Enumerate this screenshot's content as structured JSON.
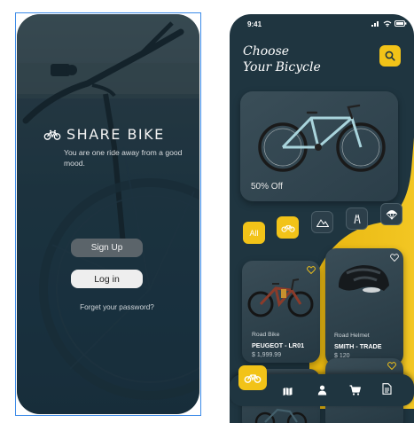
{
  "welcome": {
    "brand_name": "SHARE BIKE",
    "tagline": "You are one ride away from a good mood.",
    "signup_label": "Sign Up",
    "login_label": "Log in",
    "forgot_label": "Forget your password?"
  },
  "shop": {
    "status_time": "9:41",
    "heading_line1": "Choose",
    "heading_line2": "Your Bicycle",
    "hero_discount": "50% Off",
    "categories": [
      "All",
      "bicycle-icon",
      "mountain-icon",
      "road-icon",
      "parachute-icon"
    ],
    "products": [
      {
        "type": "Road  Bike",
        "name": "PEUGEOT - LR01",
        "price": "$ 1,999.99"
      },
      {
        "type": "Road  Helmet",
        "name": "SMITH - TRADE",
        "price": "$ 120"
      }
    ],
    "tabs": [
      "bicycle-icon",
      "map-icon",
      "user-icon",
      "cart-icon",
      "document-icon"
    ]
  },
  "colors": {
    "accent": "#f2c318",
    "dark": "#1f3540",
    "card": "#2b3e49"
  }
}
